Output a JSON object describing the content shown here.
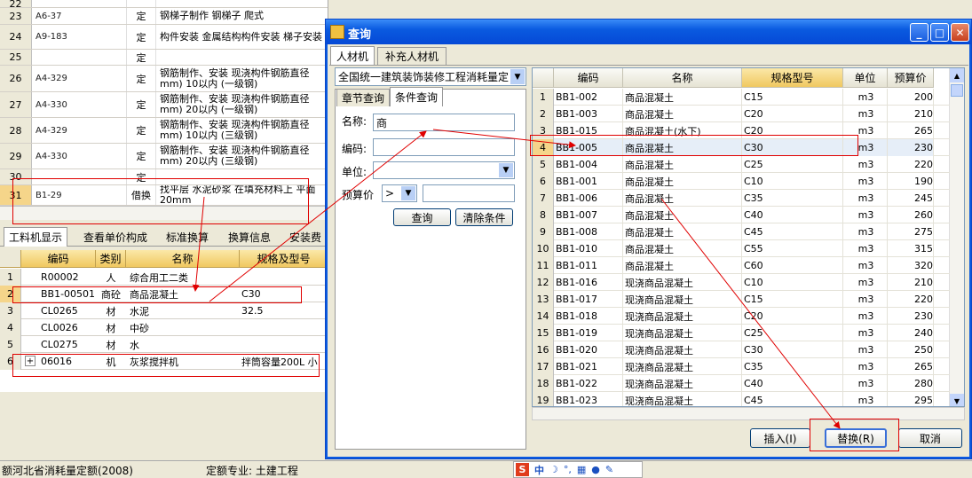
{
  "main_rows": [
    {
      "num": "22",
      "code": "",
      "type": "",
      "name": ""
    },
    {
      "num": "23",
      "code": "A6-37",
      "type": "定",
      "name": "钢梯子制作 钢梯子 爬式"
    },
    {
      "num": "24",
      "code": "A9-183",
      "type": "定",
      "name": "构件安装 金属结构构件安装 梯子安装"
    },
    {
      "num": "25",
      "code": "",
      "type": "定",
      "name": ""
    },
    {
      "num": "26",
      "code": "A4-329",
      "type": "定",
      "name": "钢筋制作、安装 现浇构件钢筋直径mm) 10以内 (一级钢)"
    },
    {
      "num": "27",
      "code": "A4-330",
      "type": "定",
      "name": "钢筋制作、安装 现浇构件钢筋直径mm) 20以内 (一级钢)"
    },
    {
      "num": "28",
      "code": "A4-329",
      "type": "定",
      "name": "钢筋制作、安装 现浇构件钢筋直径mm) 10以内 (三级钢)"
    },
    {
      "num": "29",
      "code": "A4-330",
      "type": "定",
      "name": "钢筋制作、安装 现浇构件钢筋直径mm) 20以内 (三级钢)"
    },
    {
      "num": "30",
      "code": "",
      "type": "定",
      "name": ""
    },
    {
      "num": "31",
      "code": "B1-29",
      "type": "借换",
      "name": "找平层 水泥砂浆 在填充材料上 平面 20mm"
    }
  ],
  "bottom_tabs": [
    "工料机显示",
    "查看单价构成",
    "标准换算",
    "换算信息",
    "安装费"
  ],
  "bottom_headers": [
    "编码",
    "类别",
    "名称",
    "规格及型号"
  ],
  "bottom_rows": [
    {
      "num": "1",
      "code": "R00002",
      "cat": "人",
      "name": "综合用工二类",
      "spec": ""
    },
    {
      "num": "2",
      "code": "BB1-00501",
      "cat": "商砼",
      "name": "商品混凝土",
      "spec": "C30"
    },
    {
      "num": "3",
      "code": "CL0265",
      "cat": "材",
      "name": "水泥",
      "spec": "32.5"
    },
    {
      "num": "4",
      "code": "CL0026",
      "cat": "材",
      "name": "中砂",
      "spec": ""
    },
    {
      "num": "5",
      "code": "CL0275",
      "cat": "材",
      "name": "水",
      "spec": ""
    },
    {
      "num": "6",
      "code": "06016",
      "cat": "机",
      "name": "灰浆搅拌机",
      "spec": "拌筒容量200L 小"
    }
  ],
  "status": {
    "left": "额河北省消耗量定额(2008)",
    "right": "定额专业: 土建工程"
  },
  "ime": {
    "s": "S",
    "zh": "中"
  },
  "dialog": {
    "title": "查询",
    "tabs": [
      "人材机",
      "补充人材机"
    ],
    "quota_select": "全国统一建筑装饰装修工程消耗量定",
    "sub_tabs": [
      "章节查询",
      "条件查询"
    ],
    "labels": {
      "name": "名称:",
      "code": "编码:",
      "unit": "单位:",
      "price": "预算价"
    },
    "name_value": "商",
    "price_op": ">",
    "query_btn": "查询",
    "clear_btn": "清除条件",
    "insert_btn": "插入(I)",
    "replace_btn": "替换(R)",
    "cancel_btn": "取消"
  },
  "result_headers": [
    "编码",
    "名称",
    "规格型号",
    "单位",
    "预算价"
  ],
  "results": [
    {
      "n": "1",
      "code": "BB1-002",
      "name": "商品混凝土",
      "spec": "C15",
      "unit": "m3",
      "price": "200"
    },
    {
      "n": "2",
      "code": "BB1-003",
      "name": "商品混凝土",
      "spec": "C20",
      "unit": "m3",
      "price": "210"
    },
    {
      "n": "3",
      "code": "BB1-015",
      "name": "商品混凝土(水下)",
      "spec": "C20",
      "unit": "m3",
      "price": "265"
    },
    {
      "n": "4",
      "code": "BB1-005",
      "name": "商品混凝土",
      "spec": "C30",
      "unit": "m3",
      "price": "230"
    },
    {
      "n": "5",
      "code": "BB1-004",
      "name": "商品混凝土",
      "spec": "C25",
      "unit": "m3",
      "price": "220"
    },
    {
      "n": "6",
      "code": "BB1-001",
      "name": "商品混凝土",
      "spec": "C10",
      "unit": "m3",
      "price": "190"
    },
    {
      "n": "7",
      "code": "BB1-006",
      "name": "商品混凝土",
      "spec": "C35",
      "unit": "m3",
      "price": "245"
    },
    {
      "n": "8",
      "code": "BB1-007",
      "name": "商品混凝土",
      "spec": "C40",
      "unit": "m3",
      "price": "260"
    },
    {
      "n": "9",
      "code": "BB1-008",
      "name": "商品混凝土",
      "spec": "C45",
      "unit": "m3",
      "price": "275"
    },
    {
      "n": "10",
      "code": "BB1-010",
      "name": "商品混凝土",
      "spec": "C55",
      "unit": "m3",
      "price": "315"
    },
    {
      "n": "11",
      "code": "BB1-011",
      "name": "商品混凝土",
      "spec": "C60",
      "unit": "m3",
      "price": "320"
    },
    {
      "n": "12",
      "code": "BB1-016",
      "name": "现浇商品混凝土",
      "spec": "C10",
      "unit": "m3",
      "price": "210"
    },
    {
      "n": "13",
      "code": "BB1-017",
      "name": "现浇商品混凝土",
      "spec": "C15",
      "unit": "m3",
      "price": "220"
    },
    {
      "n": "14",
      "code": "BB1-018",
      "name": "现浇商品混凝土",
      "spec": "C20",
      "unit": "m3",
      "price": "230"
    },
    {
      "n": "15",
      "code": "BB1-019",
      "name": "现浇商品混凝土",
      "spec": "C25",
      "unit": "m3",
      "price": "240"
    },
    {
      "n": "16",
      "code": "BB1-020",
      "name": "现浇商品混凝土",
      "spec": "C30",
      "unit": "m3",
      "price": "250"
    },
    {
      "n": "17",
      "code": "BB1-021",
      "name": "现浇商品混凝土",
      "spec": "C35",
      "unit": "m3",
      "price": "265"
    },
    {
      "n": "18",
      "code": "BB1-022",
      "name": "现浇商品混凝土",
      "spec": "C40",
      "unit": "m3",
      "price": "280"
    },
    {
      "n": "19",
      "code": "BB1-023",
      "name": "现浇商品混凝土",
      "spec": "C45",
      "unit": "m3",
      "price": "295"
    }
  ]
}
